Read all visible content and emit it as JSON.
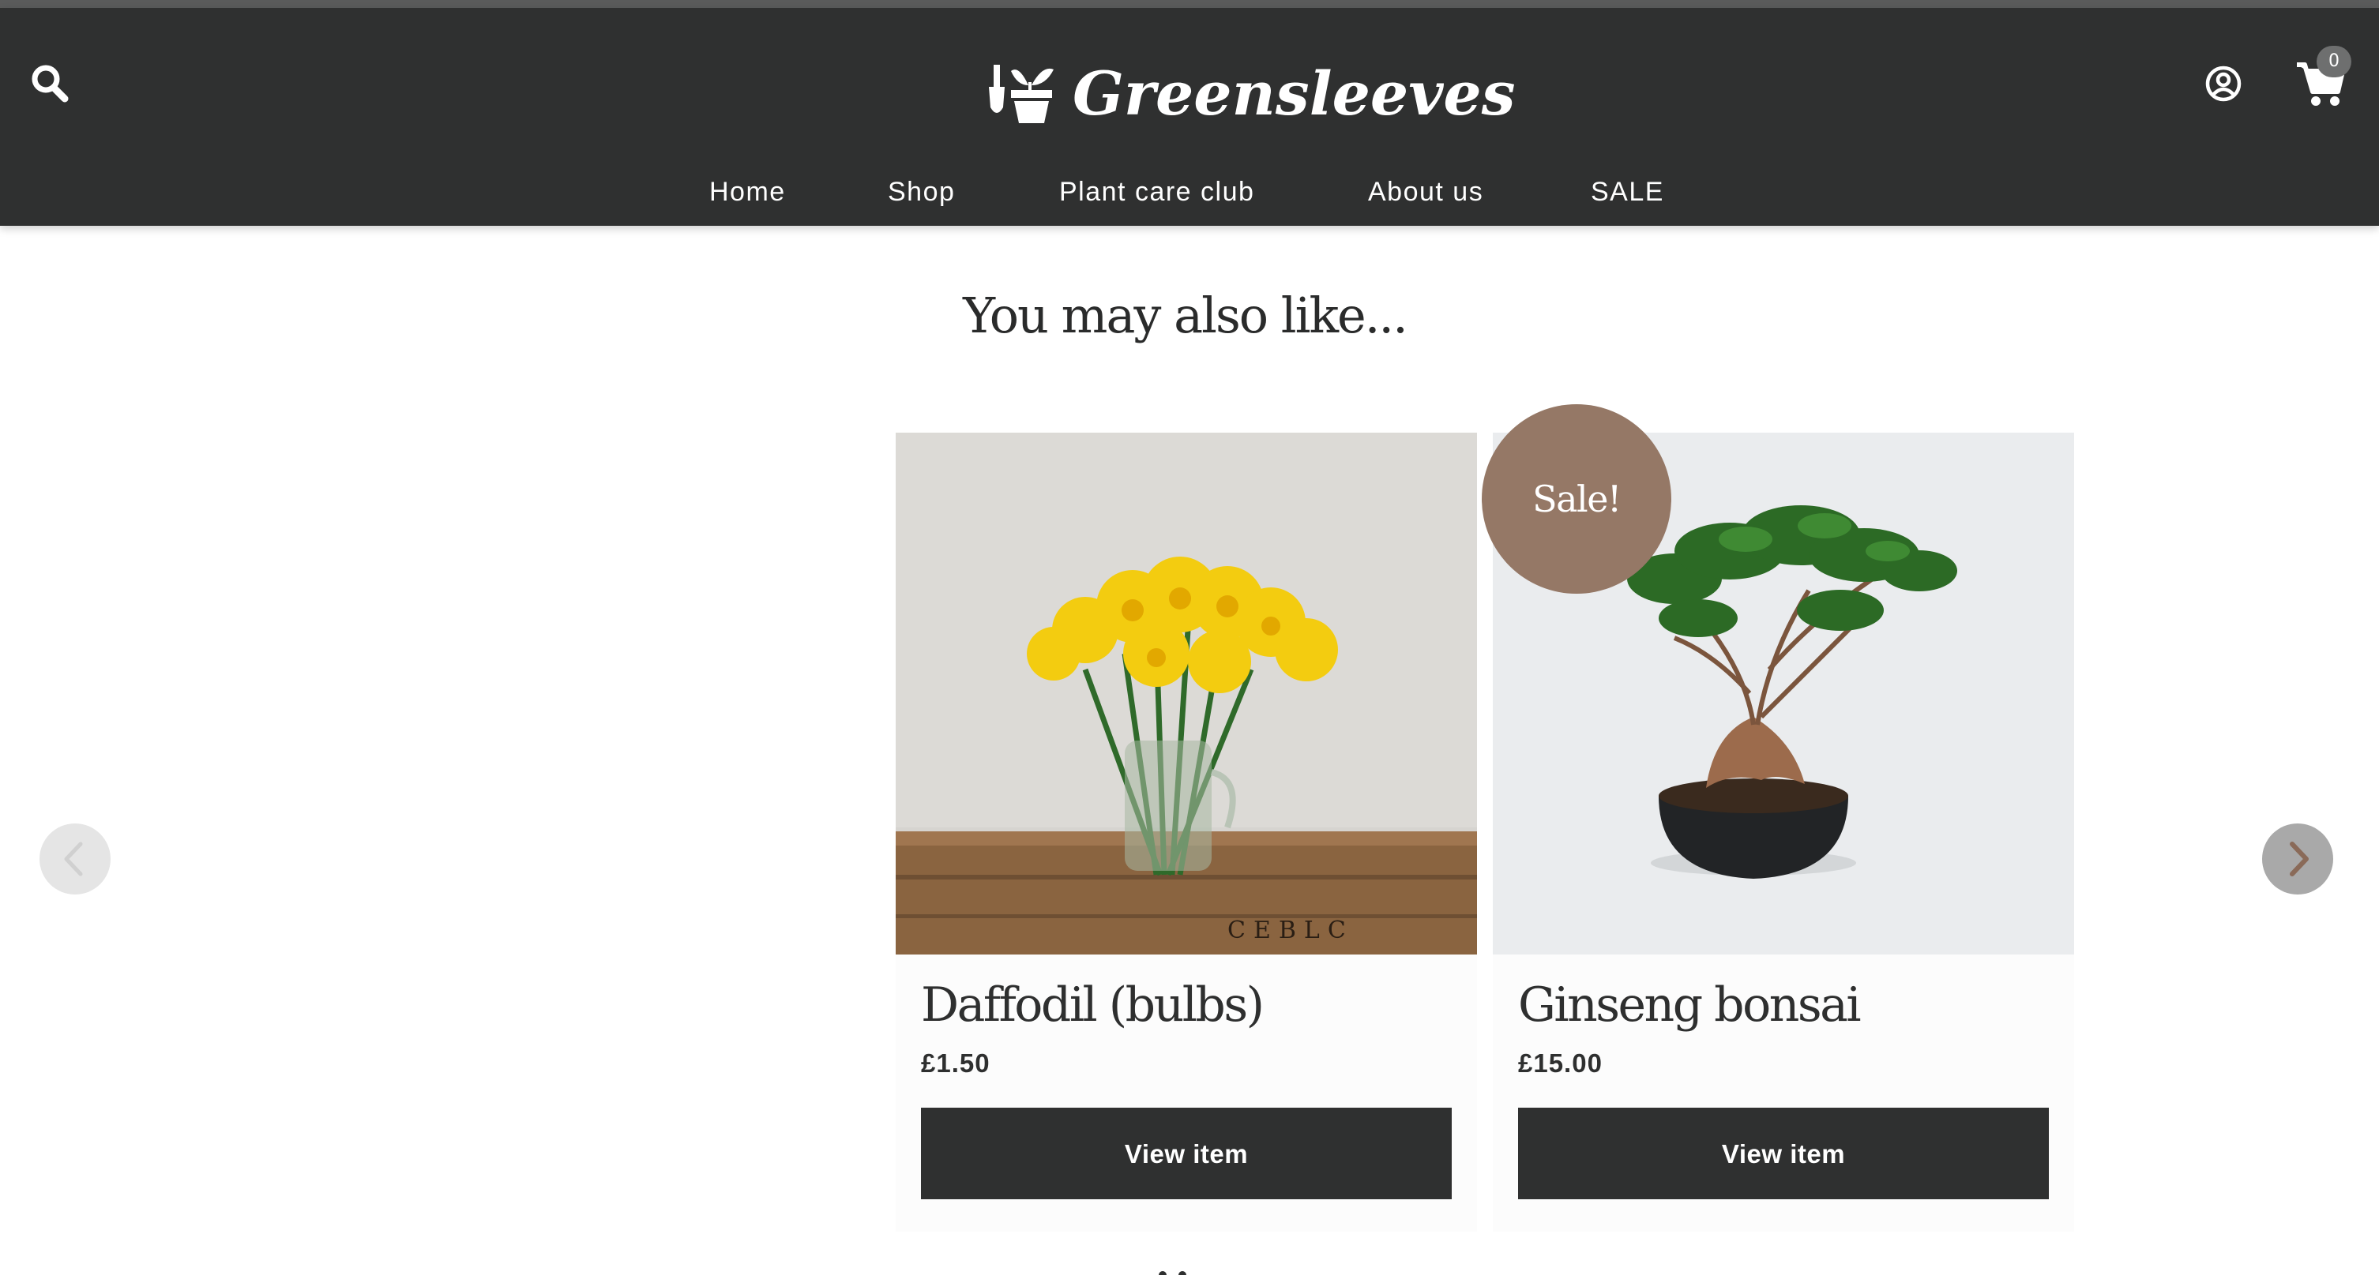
{
  "header": {
    "logo_text": "Greensleeves",
    "cart_count": "0",
    "icons": {
      "search": "search-icon",
      "account": "user-circle-icon",
      "cart": "shopping-cart-icon",
      "logo": "plant-pot-trowel-icon"
    }
  },
  "nav": {
    "items": [
      {
        "label": "Home"
      },
      {
        "label": "Shop"
      },
      {
        "label": "Plant care club"
      },
      {
        "label": "About us"
      },
      {
        "label": "SALE"
      }
    ]
  },
  "section": {
    "title": "You may also like..."
  },
  "products": [
    {
      "name": "Daffodil (bulbs)",
      "price": "£1.50",
      "button": "View item",
      "image": "daffodils-in-jar-photo"
    },
    {
      "name": "Ginseng bonsai",
      "price": "£15.00",
      "button": "View item",
      "image": "ginseng-bonsai-photo",
      "badge": "Sale!"
    }
  ],
  "carousel": {
    "prev_icon": "chevron-left-icon",
    "next_icon": "chevron-right-icon"
  },
  "colors": {
    "header_bg": "#2f3030",
    "sale_badge": "#957866",
    "button_bg": "#2f3030",
    "page_bg": "#ffffff"
  }
}
